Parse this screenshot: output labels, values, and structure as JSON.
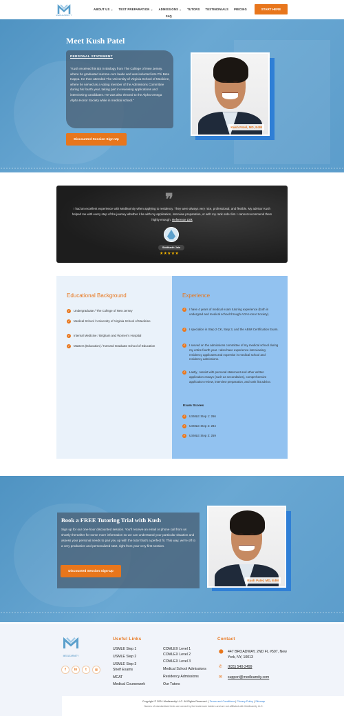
{
  "brand": {
    "logo_text": "MEDLEARNITY",
    "accent": "#e8761c",
    "primary": "#4f93c2"
  },
  "nav": {
    "items": [
      "ABOUT US ⌄",
      "TEST PREPARATION ⌄",
      "ADMISSIONS ⌄",
      "TUTORS",
      "TESTIMONIALS",
      "PRICING"
    ],
    "faq": "FAQ",
    "cta": "START HERE"
  },
  "hero": {
    "title": "Meet Kush Patel",
    "statement_heading": "PERSONAL STATEMENT",
    "statement_text": "\"Kush received his BS in Biology from The College of New Jersey, where he graduated summa cum laude and was inducted into Phi Beta Kappa. He then attended The University of Virginia School of Medicine, where he served as a voting member of the Admissions Committee during his fourth year, taking part in reviewing applications and interviewing candidates. He was also elected to the Alpha Omega Alpha Honor Society while in medical school.\"",
    "button": "Discounted Session Sign-Up",
    "photo_caption": "Kush Patel, MD, EdM"
  },
  "testimonial": {
    "quote_mark": "❞",
    "text": "I had an excellent experience with Medlearnity when applying to residency. They were always very nice, professional, and flexible. My advisor Kush helped me with every step of the journey whether it be with my application, interview preparation, or with my rank order list. I cannot recommend them highly enough.",
    "link": "Reference Link",
    "name": "Siddharth Jain",
    "stars": "★★★★★"
  },
  "education": {
    "heading": "Educational Background",
    "items": [
      "Undergraduate / The College of New Jersey",
      "Medical School / University of Virginia School of Medicine",
      "Internal Medicine / Brigham and Women's Hospital",
      "Masters (Education) / Harvard Graduate School of Education"
    ]
  },
  "experience": {
    "heading": "Experience",
    "items": [
      "I have 4 years of medical exam tutoring experience (both in undergrad and medical school through AOA Honor Society).",
      "I specialize in Step 2 CK, Step 3, and the ABIM Certification Exam.",
      "I served on the admissions committee of my medical school during my entire fourth year. I also have experience interviewing residency applicants and expertise in medical school and residency admissions.",
      "Lastly, I assist with personal statement and other written application essays (such as secondaries), comprehensive application review, interview preparation, and rank list advice."
    ],
    "scores_heading": "Exam Scores",
    "scores": [
      "USMLE Step 1: 266",
      "USMLE Step 2: 284",
      "USMLE Step 3: 259"
    ]
  },
  "trial": {
    "title": "Book a FREE Tutoring Trial with Kush",
    "text": "Sign up for our one-hour discounted session. You'll receive an email or phone call from us shortly thereafter for some more information so we can understand your particular situation and assess your personal needs to pair you up with the tutor that's a perfect fit. This way, we're off to a very productive and personalized start, right from your very first session.",
    "button": "Discounted Session Sign-Up",
    "photo_caption": "Kush Patel, MD, EdM"
  },
  "footer": {
    "logo_text": "MEDLEARNITY",
    "social": [
      "f",
      "in",
      "t",
      "◎"
    ],
    "useful_heading": "Useful Links",
    "links_col1": [
      "USMLE Step 1",
      "USMLE Step 2",
      "USMLE Step 3",
      "Shelf Exams",
      "MCAT",
      "Medical Coursework"
    ],
    "links_col2": [
      "COMLEX Level 1",
      "COMLEX Level 2",
      "COMLEX Level 3",
      "Medical School Admissions",
      "Residency Admissions",
      "Our Tutors"
    ],
    "contact_heading": "Contact",
    "address": "447 BROADWAY, 2ND FL #507, New York, NY, 10013",
    "phone": "(631) 540-2499",
    "email": "support@medlearnity.com",
    "copyright": "Copyright © 2024 Medlearnity LLC. All Rights Reserved. |",
    "terms": "Terms and Conditions",
    "privacy": "Privacy Policy",
    "sitemap": "Sitemap",
    "disclaimer": "Names of standardized tests are owned by the trademark holders and are not affiliated with Medlearnity LLC."
  }
}
